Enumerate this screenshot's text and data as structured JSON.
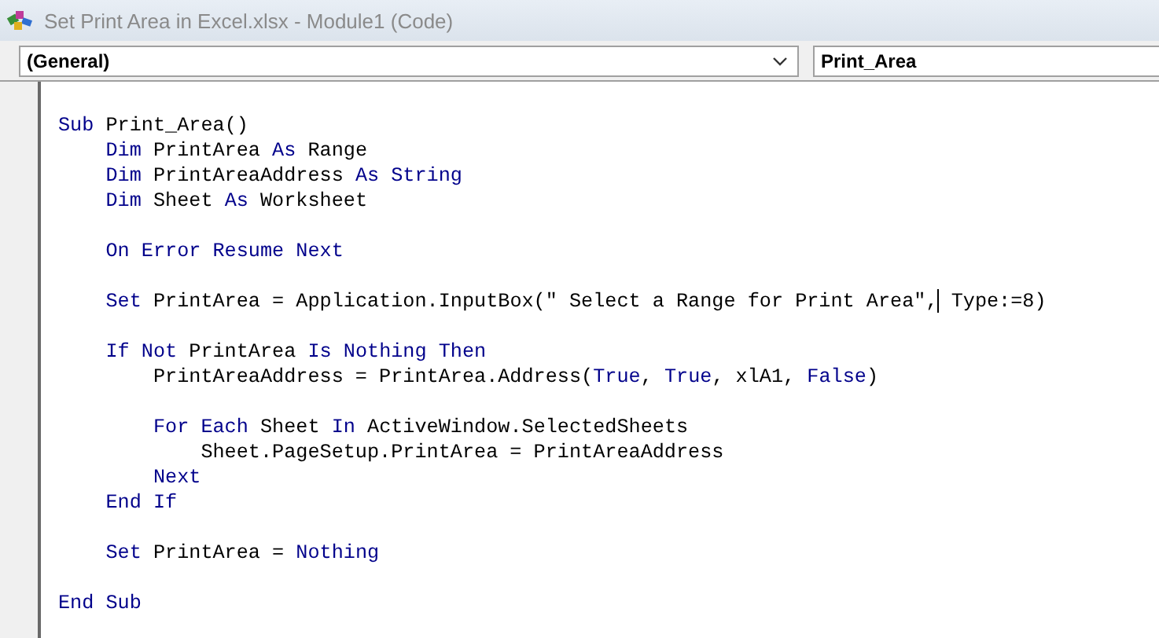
{
  "window": {
    "title": "Set Print Area in Excel.xlsx - Module1 (Code)"
  },
  "object_box": {
    "value": "(General)"
  },
  "procedure_box": {
    "value": "Print_Area"
  },
  "code_lines": [
    {
      "kind": "blank"
    },
    {
      "kind": "code",
      "tokens": [
        {
          "kind": "keyword",
          "text": "Sub"
        },
        {
          "kind": "plain",
          "text": " Print_Area()"
        }
      ]
    },
    {
      "kind": "code",
      "tokens": [
        {
          "kind": "keyword",
          "text": "    Dim"
        },
        {
          "kind": "plain",
          "text": " PrintArea "
        },
        {
          "kind": "keyword",
          "text": "As"
        },
        {
          "kind": "plain",
          "text": " Range"
        }
      ]
    },
    {
      "kind": "code",
      "tokens": [
        {
          "kind": "keyword",
          "text": "    Dim"
        },
        {
          "kind": "plain",
          "text": " PrintAreaAddress "
        },
        {
          "kind": "keyword",
          "text": "As String"
        }
      ]
    },
    {
      "kind": "code",
      "tokens": [
        {
          "kind": "keyword",
          "text": "    Dim"
        },
        {
          "kind": "plain",
          "text": " Sheet "
        },
        {
          "kind": "keyword",
          "text": "As"
        },
        {
          "kind": "plain",
          "text": " Worksheet"
        }
      ]
    },
    {
      "kind": "blank"
    },
    {
      "kind": "code",
      "tokens": [
        {
          "kind": "keyword",
          "text": "    On Error Resume Next"
        }
      ]
    },
    {
      "kind": "blank"
    },
    {
      "kind": "code",
      "tokens": [
        {
          "kind": "keyword",
          "text": "    Set"
        },
        {
          "kind": "plain",
          "text": " PrintArea = Application.InputBox(\" Select a Range for Print Area\","
        },
        {
          "kind": "cursor"
        },
        {
          "kind": "plain",
          "text": " Type:=8)"
        }
      ]
    },
    {
      "kind": "blank"
    },
    {
      "kind": "code",
      "tokens": [
        {
          "kind": "keyword",
          "text": "    If Not"
        },
        {
          "kind": "plain",
          "text": " PrintArea "
        },
        {
          "kind": "keyword",
          "text": "Is Nothing Then"
        }
      ]
    },
    {
      "kind": "code",
      "tokens": [
        {
          "kind": "plain",
          "text": "        PrintAreaAddress = PrintArea.Address("
        },
        {
          "kind": "keyword",
          "text": "True"
        },
        {
          "kind": "plain",
          "text": ", "
        },
        {
          "kind": "keyword",
          "text": "True"
        },
        {
          "kind": "plain",
          "text": ", xlA1, "
        },
        {
          "kind": "keyword",
          "text": "False"
        },
        {
          "kind": "plain",
          "text": ")"
        }
      ]
    },
    {
      "kind": "blank"
    },
    {
      "kind": "code",
      "tokens": [
        {
          "kind": "keyword",
          "text": "        For Each"
        },
        {
          "kind": "plain",
          "text": " Sheet "
        },
        {
          "kind": "keyword",
          "text": "In"
        },
        {
          "kind": "plain",
          "text": " ActiveWindow.SelectedSheets"
        }
      ]
    },
    {
      "kind": "code",
      "tokens": [
        {
          "kind": "plain",
          "text": "            Sheet.PageSetup.PrintArea = PrintAreaAddress"
        }
      ]
    },
    {
      "kind": "code",
      "tokens": [
        {
          "kind": "keyword",
          "text": "        Next"
        }
      ]
    },
    {
      "kind": "code",
      "tokens": [
        {
          "kind": "keyword",
          "text": "    End If"
        }
      ]
    },
    {
      "kind": "blank"
    },
    {
      "kind": "code",
      "tokens": [
        {
          "kind": "keyword",
          "text": "    Set"
        },
        {
          "kind": "plain",
          "text": " PrintArea = "
        },
        {
          "kind": "keyword",
          "text": "Nothing"
        }
      ]
    },
    {
      "kind": "blank"
    },
    {
      "kind": "code",
      "tokens": [
        {
          "kind": "keyword",
          "text": "End Sub"
        }
      ]
    }
  ]
}
